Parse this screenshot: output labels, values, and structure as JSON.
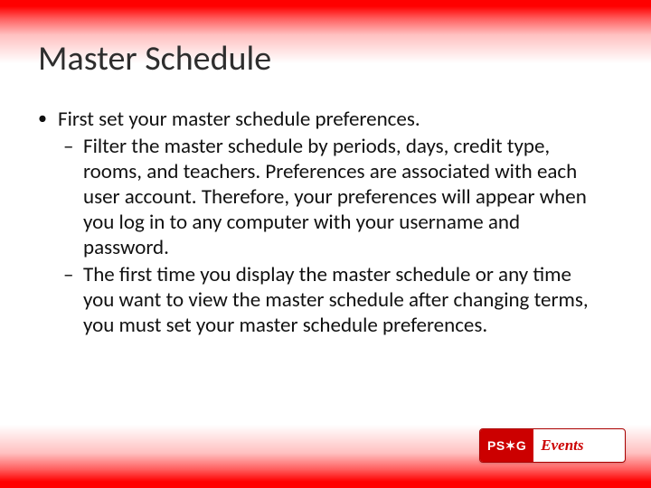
{
  "title": "Master Schedule",
  "bullets": [
    {
      "text": "First set your master schedule preferences.",
      "sub": [
        "Filter the master schedule by periods, days, credit type, rooms, and teachers. Preferences are associated with each user account. Therefore, your preferences will appear when you log in to any computer with your username and password.",
        "The first time you display the master schedule or any time you want to view the master schedule after changing terms, you must set your master schedule preferences."
      ]
    }
  ],
  "logo": {
    "left": "PS✶G",
    "right": "Events"
  }
}
